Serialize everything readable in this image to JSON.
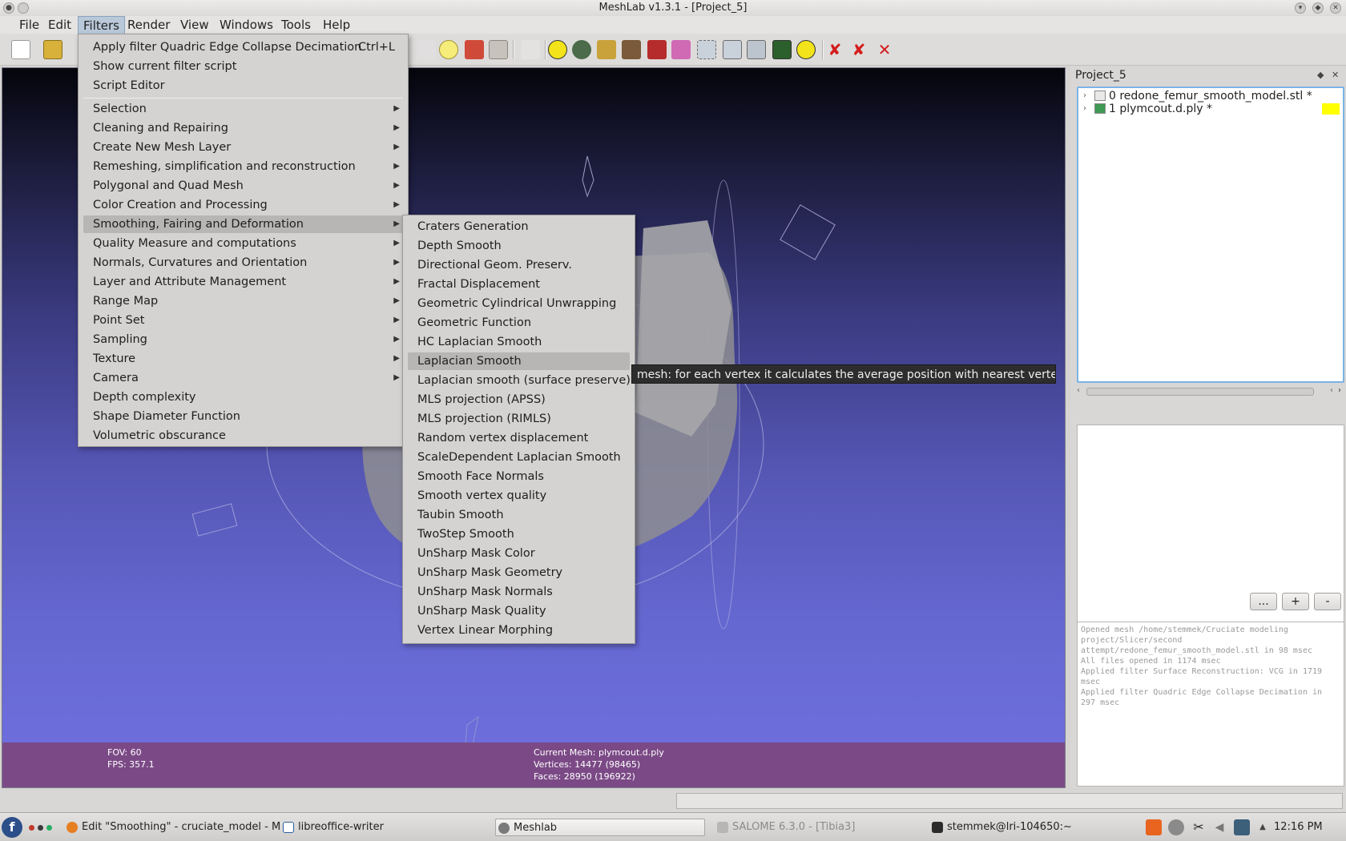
{
  "window": {
    "title": "MeshLab v1.3.1 - [Project_5]"
  },
  "menubar": {
    "items": [
      "File",
      "Edit",
      "Filters",
      "Render",
      "View",
      "Windows",
      "Tools",
      "Help"
    ],
    "active": "Filters"
  },
  "filters_menu": {
    "top_items": [
      {
        "label": "Apply filter Quadric Edge Collapse Decimation",
        "shortcut": "Ctrl+L"
      },
      {
        "label": "Show current filter script"
      },
      {
        "label": "Script Editor"
      }
    ],
    "categories": [
      "Selection",
      "Cleaning and Repairing",
      "Create New Mesh Layer",
      "Remeshing, simplification and reconstruction",
      "Polygonal and Quad Mesh",
      "Color Creation and Processing",
      "Smoothing, Fairing and Deformation",
      "Quality Measure and computations",
      "Normals, Curvatures and Orientation",
      "Layer and Attribute Management",
      "Range Map",
      "Point Set",
      "Sampling",
      "Texture",
      "Camera",
      "Depth complexity",
      "Shape Diameter Function",
      "Volumetric obscurance"
    ],
    "highlighted_category": "Smoothing, Fairing and Deformation"
  },
  "smoothing_submenu": {
    "items": [
      "Craters Generation",
      "Depth Smooth",
      "Directional Geom. Preserv.",
      "Fractal Displacement",
      "Geometric Cylindrical Unwrapping",
      "Geometric Function",
      "HC Laplacian Smooth",
      "Laplacian Smooth",
      "Laplacian smooth (surface preserve)",
      "MLS projection (APSS)",
      "MLS projection (RIMLS)",
      "Random vertex displacement",
      "ScaleDependent Laplacian Smooth",
      "Smooth Face Normals",
      "Smooth vertex quality",
      "Taubin Smooth",
      "TwoStep Smooth",
      "UnSharp Mask Color",
      "UnSharp Mask Geometry",
      "UnSharp Mask Normals",
      "UnSharp Mask Quality",
      "Vertex Linear Morphing"
    ],
    "highlighted": "Laplacian Smooth"
  },
  "tooltip": {
    "text": "mesh: for each vertex it calculates the average position with nearest vertex"
  },
  "viewport": {
    "fov": "FOV: 60",
    "fps": "FPS:  357.1",
    "current_mesh": "Current Mesh: plymcout.d.ply",
    "vertices": "Vertices: 14477 (98465)",
    "faces": "Faces: 28950 (196922)"
  },
  "panel": {
    "title": "Project_5",
    "layers": [
      {
        "name": "0  redone_femur_smooth_model.stl *"
      },
      {
        "name": "1  plymcout.d.ply *"
      }
    ],
    "buttons": [
      "...",
      "+",
      "-"
    ],
    "log": [
      "Opened mesh /home/stemmek/Cruciate modeling project/Slicer/second attempt/redone_femur_smooth_model.stl in 98 msec",
      "All files opened in 1174 msec",
      "Applied filter Surface Reconstruction: VCG in 1719 msec",
      "Applied filter Quadric Edge Collapse Decimation in 297 msec"
    ]
  },
  "taskbar": {
    "tasks": [
      {
        "label": "Edit \"Smoothing\" - cruciate_model - M"
      },
      {
        "label": "libreoffice-writer"
      },
      {
        "label": "Meshlab"
      },
      {
        "label": "SALOME 6.3.0 - [Tibia3]"
      },
      {
        "label": "stemmek@lri-104650:~"
      }
    ],
    "clock": "12:16 PM"
  },
  "colors": {
    "viewport_bottom": "#7070e0",
    "info_strip": "#7b4a86",
    "selection_border": "#7ab3e6",
    "layer_color_swatch": "#ffff00"
  }
}
